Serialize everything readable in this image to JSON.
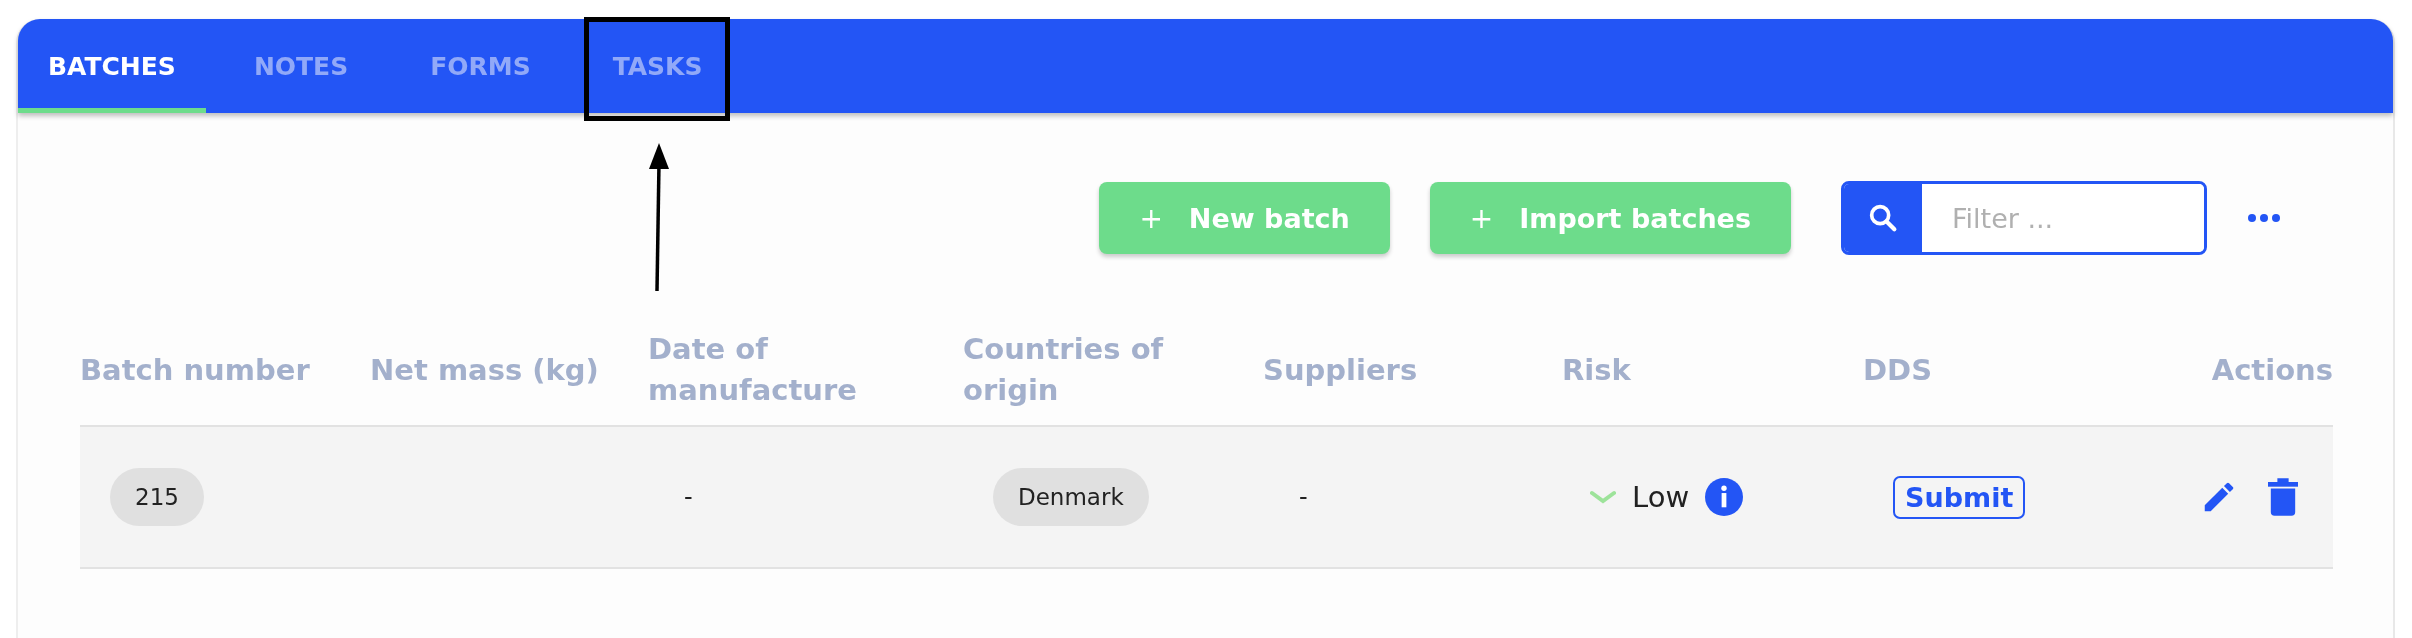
{
  "tabs": [
    {
      "label": "BATCHES",
      "selected": true
    },
    {
      "label": "NOTES",
      "selected": false
    },
    {
      "label": "FORMS",
      "selected": false
    },
    {
      "label": "TASKS",
      "selected": false
    }
  ],
  "toolbar": {
    "buttons": [
      {
        "icon": "+",
        "label": "New batch"
      },
      {
        "icon": "+",
        "label": "Import batches"
      }
    ],
    "filter": {
      "placeholder": "Filter ..."
    }
  },
  "table": {
    "columns": [
      "Batch number",
      "Net mass (kg)",
      "Date of manufacture",
      "Countries of origin",
      "Suppliers",
      "Risk",
      "DDS",
      "Actions"
    ],
    "rows": [
      {
        "batch_number": "215",
        "date_of_manufacture": "-",
        "countries_of_origin": [
          "Denmark"
        ],
        "suppliers": "-",
        "risk": "Low",
        "dds": "Submit"
      }
    ]
  }
}
